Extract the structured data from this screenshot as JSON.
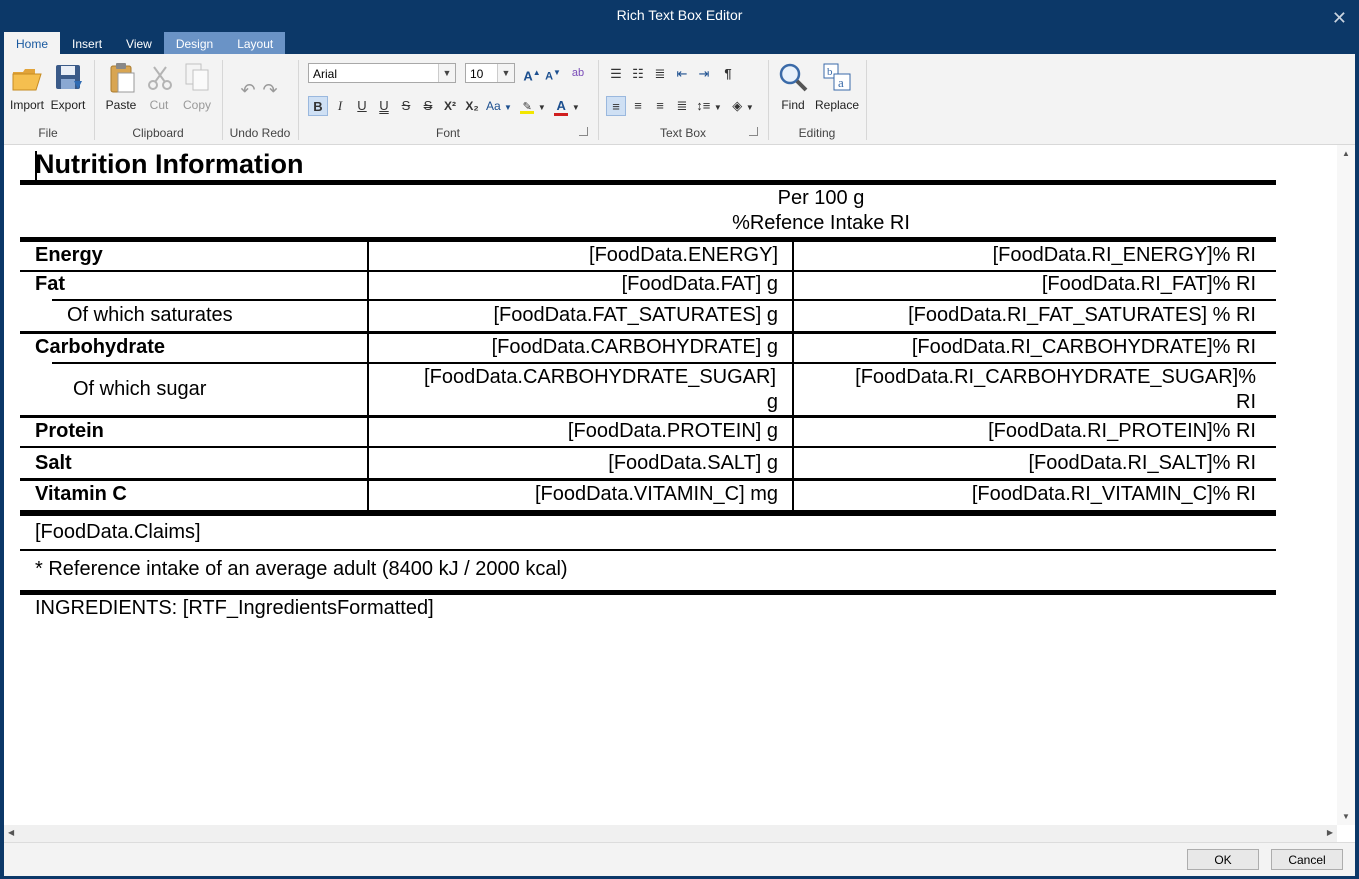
{
  "window": {
    "title": "Rich Text Box Editor",
    "close": "✕"
  },
  "tabs": [
    "Home",
    "Insert",
    "View",
    "Design",
    "Layout"
  ],
  "ribbon": {
    "file": {
      "label": "File",
      "import": "Import",
      "export": "Export"
    },
    "clipboard": {
      "label": "Clipboard",
      "paste": "Paste",
      "cut": "Cut",
      "copy": "Copy"
    },
    "undo_redo": {
      "label": "Undo Redo"
    },
    "font": {
      "label": "Font",
      "family": "Arial",
      "size": "10",
      "bold": "B",
      "italic": "I",
      "underline": "U",
      "double_underline": "U",
      "strike": "S",
      "double_strike": "S",
      "superscript": "X²",
      "subscript": "X₂",
      "case": "Aa",
      "grow": "A",
      "shrink": "A"
    },
    "textbox": {
      "label": "Text Box",
      "pilcrow": "¶"
    },
    "editing": {
      "label": "Editing",
      "find": "Find",
      "replace": "Replace"
    }
  },
  "document": {
    "heading": "Nutrition Information",
    "col_header_1": "Per 100 g",
    "col_header_2": "%Refence Intake RI",
    "rows": [
      {
        "label": "Energy",
        "value": "[FoodData.ENERGY]",
        "ri": "[FoodData.RI_ENERGY]% RI"
      },
      {
        "label": "Fat",
        "value": "[FoodData.FAT]  g",
        "ri": "[FoodData.RI_FAT]% RI"
      },
      {
        "label": "Of which saturates",
        "value": "[FoodData.FAT_SATURATES] g",
        "ri": "[FoodData.RI_FAT_SATURATES] % RI"
      },
      {
        "label": "Carbohydrate",
        "value": "[FoodData.CARBOHYDRATE] g",
        "ri": "[FoodData.RI_CARBOHYDRATE]% RI"
      },
      {
        "label": "Of which sugar",
        "value_line1": "[FoodData.CARBOHYDRATE_SUGAR]",
        "value_line2": "g",
        "ri_line1": "[FoodData.RI_CARBOHYDRATE_SUGAR]%",
        "ri_line2": "RI"
      },
      {
        "label": "Protein",
        "value": "[FoodData.PROTEIN] g",
        "ri": "[FoodData.RI_PROTEIN]% RI"
      },
      {
        "label": "Salt",
        "value": "[FoodData.SALT] g",
        "ri": "[FoodData.RI_SALT]% RI"
      },
      {
        "label": "Vitamin C",
        "value": "[FoodData.VITAMIN_C]  mg",
        "ri": "[FoodData.RI_VITAMIN_C]% RI"
      }
    ],
    "claims": "[FoodData.Claims]",
    "reference_note": "* Reference intake of an average adult (8400 kJ / 2000 kcal)",
    "ingredients": "INGREDIENTS: [RTF_IngredientsFormatted]"
  },
  "buttons": {
    "ok": "OK",
    "cancel": "Cancel"
  }
}
